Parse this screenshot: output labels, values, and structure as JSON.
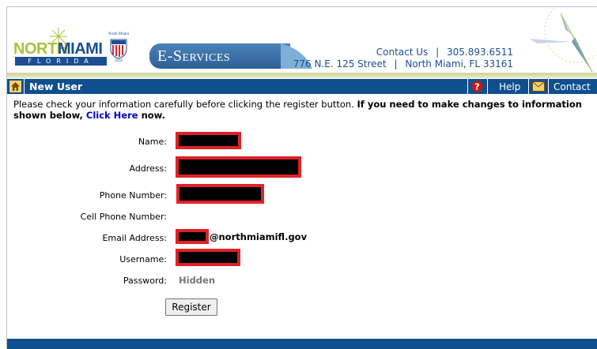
{
  "header": {
    "logo": {
      "north": "NORTH",
      "miami": "MIAMI",
      "florida": "FLORIDA"
    },
    "seal": {
      "title": "North Miami",
      "year": "2016"
    },
    "eservices_label": "E-Services",
    "contact_us": "Contact Us",
    "phone": "305.893.6511",
    "address_street": "776 N.E. 125 Street",
    "address_city": "North Miami, FL 33161",
    "separator": "|"
  },
  "titlebar": {
    "title": "New User",
    "help": "Help",
    "contact": "Contact"
  },
  "intro": {
    "text": "Please check your information carefully before clicking the register button. ",
    "bold_text": "If you need to make changes to information shown below, ",
    "link": "Click Here",
    "tail": " now."
  },
  "form": {
    "name_label": "Name:",
    "address_label": "Address:",
    "phone_label": "Phone Number:",
    "cell_label": "Cell Phone Number:",
    "email_label": "Email Address:",
    "email_domain": "@northmiamifl.gov",
    "username_label": "Username:",
    "password_label": "Password:",
    "password_value": "Hidden",
    "register_button": "Register"
  },
  "colors": {
    "brand_blue": "#0f4f8e",
    "logo_green": "#a9c23c",
    "redaction_border": "#e02127",
    "link_blue": "#0000cc"
  }
}
